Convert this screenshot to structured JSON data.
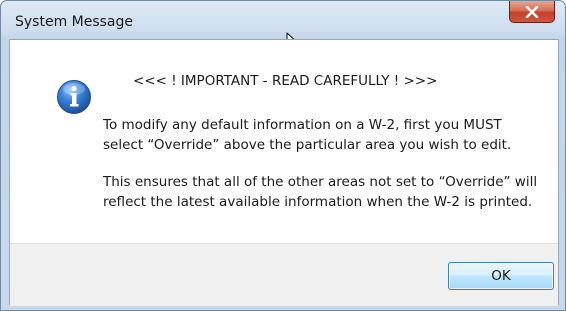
{
  "window": {
    "title": "System Message"
  },
  "message": {
    "heading": "<<< ! IMPORTANT - READ CAREFULLY ! >>>",
    "paragraph1": "To modify any default information on a W-2, first you MUST select “Override” above the particular area you wish to edit.",
    "paragraph2": "This ensures that all of the other areas not set to “Override” will reflect the latest available information when the W-2 is printed."
  },
  "buttons": {
    "ok_label": "OK"
  },
  "icons": {
    "message_icon": "info-icon",
    "close_icon": "close-icon",
    "cursor": "mouse-pointer-icon"
  },
  "colors": {
    "close_button": "#c2422b",
    "info_icon": "#2f6fc6",
    "ok_button_border": "#3c7fb1"
  }
}
